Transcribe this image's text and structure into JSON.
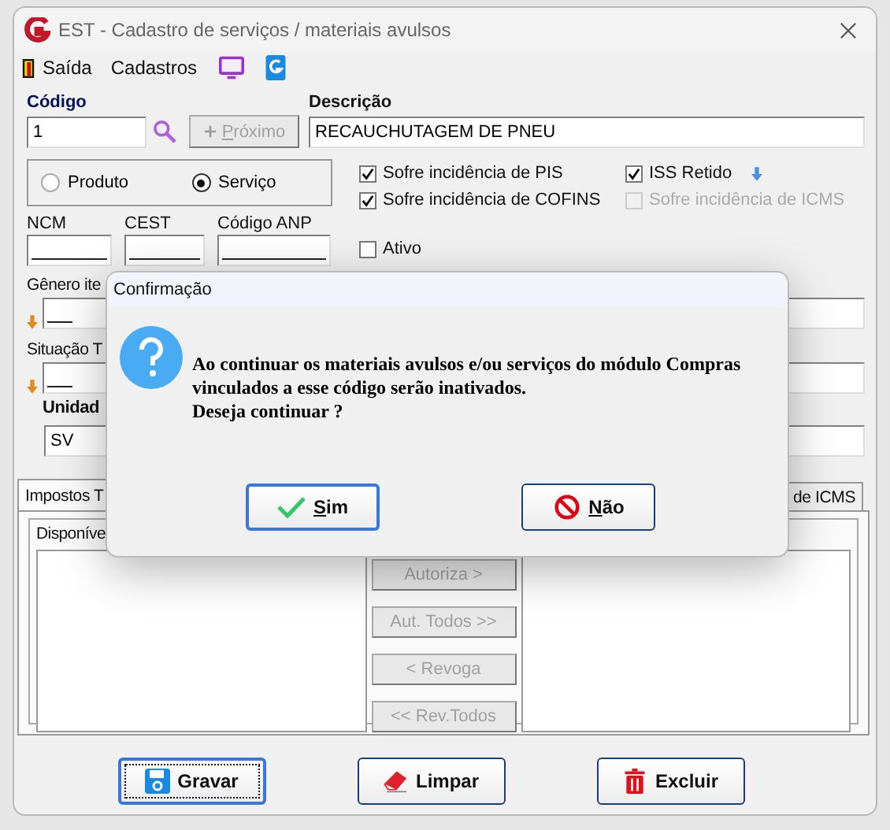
{
  "window": {
    "title": "EST - Cadastro de serviços / materiais avulsos"
  },
  "menu": [
    {
      "label": "Saída",
      "kind": "exit"
    },
    {
      "label": "Cadastros",
      "kind": "text"
    }
  ],
  "codigo": {
    "label": "Código",
    "value": "1"
  },
  "proximo": {
    "label": "Próximo",
    "disabled": true
  },
  "descricao": {
    "label": "Descrição",
    "value": "RECAUCHUTAGEM DE PNEU"
  },
  "tipo": [
    {
      "label": "Produto",
      "selected": false
    },
    {
      "label": "Serviço",
      "selected": true
    }
  ],
  "checkboxes": [
    {
      "label": "Sofre incidência de PIS",
      "checked": true,
      "disabled": false,
      "kind": "plain"
    },
    {
      "label": "ISS Retido",
      "checked": true,
      "disabled": false,
      "kind": "arrow"
    },
    {
      "label": "Sofre incidência de COFINS",
      "checked": true,
      "disabled": false,
      "kind": "plain"
    },
    {
      "label": "Sofre incidência de ICMS",
      "checked": false,
      "disabled": true,
      "kind": "plain"
    }
  ],
  "codes": [
    {
      "label": "NCM"
    },
    {
      "label": "CEST"
    },
    {
      "label": "Código ANP"
    }
  ],
  "ativo": {
    "label": "Ativo",
    "checked": false
  },
  "genero": {
    "label": "Gênero ite"
  },
  "situacao": {
    "label": "Situação T"
  },
  "unidade": {
    "label": "Unidad",
    "value": "SV"
  },
  "tabs": [
    {
      "label": "Impostos T",
      "selected": true
    },
    {
      "label": "de ICMS",
      "selected": false
    }
  ],
  "panel": {
    "group_label": "Disponíve",
    "buttons": [
      {
        "label": "Autoriza >",
        "disabled": true
      },
      {
        "label": "Aut. Todos >>",
        "disabled": true
      },
      {
        "label": "< Revoga",
        "disabled": true
      },
      {
        "label": "<< Rev.Todos",
        "disabled": true
      }
    ]
  },
  "actions": [
    {
      "label": "Gravar",
      "kind": "save",
      "focused": true
    },
    {
      "label": "Limpar",
      "kind": "eraser",
      "focused": false
    },
    {
      "label": "Excluir",
      "kind": "trash",
      "focused": false
    }
  ],
  "dialog": {
    "title": "Confirmação",
    "message": "Ao continuar os materiais avulsos e/ou serviços do módulo Compras\nvinculados a esse código serão inativados.\nDeseja continuar ?",
    "buttons": [
      {
        "label": "Sim",
        "kind": "ok",
        "focused": true
      },
      {
        "label": "Não",
        "kind": "cancel",
        "focused": false
      }
    ]
  }
}
